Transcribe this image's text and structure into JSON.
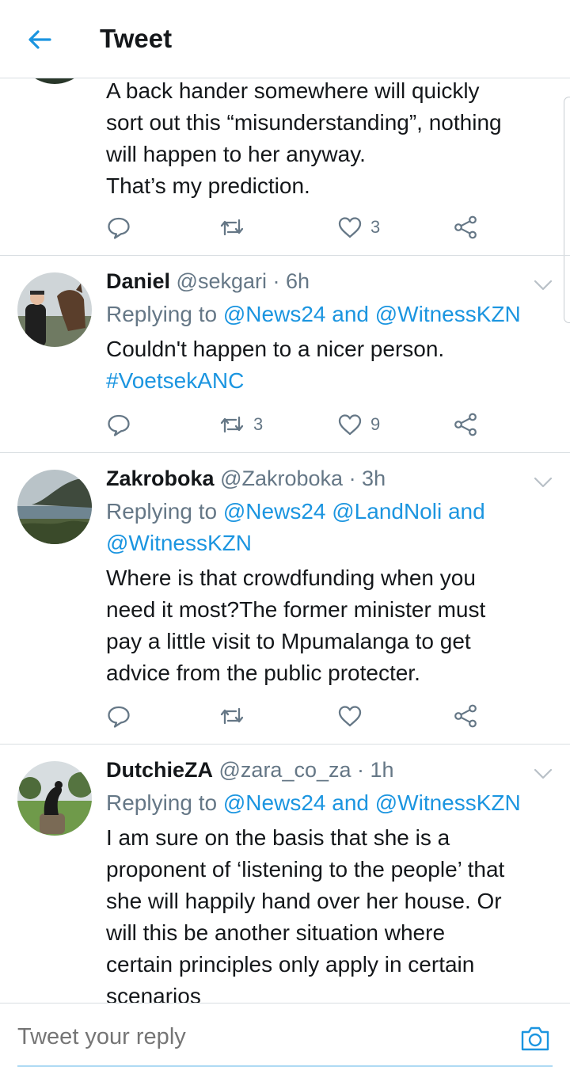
{
  "header": {
    "title": "Tweet",
    "back_icon": "arrow-left-icon",
    "accent": "#1b95e0"
  },
  "tweets": [
    {
      "text_lines": [
        "A back hander somewhere will quickly",
        "sort out this “misunderstanding”, nothing",
        "will happen to her anyway.",
        "That’s my prediction."
      ],
      "likes": "3"
    },
    {
      "name": "Daniel",
      "handle": "@sekgari",
      "time": "· 6h",
      "reply_prefix": "Replying to",
      "reply_line1_a": "@News24",
      "reply_line1_and": "and",
      "reply_line1_b": "@WitnessKZN",
      "text_lines": [
        "Couldn't happen to a nicer person."
      ],
      "hashtag": "#VoetsekANC",
      "retweets": "3",
      "likes": "9"
    },
    {
      "name": "Zakroboka",
      "handle": "@Zakroboka",
      "time": "· 3h",
      "reply_prefix": "Replying to",
      "reply_line1_a": "@News24",
      "reply_line1_b": "@LandNoli",
      "reply_line1_and": "and",
      "reply_line2": "@WitnessKZN",
      "text_lines": [
        "Where is that crowdfunding when you",
        "need it most?The former minister must",
        "pay a little visit to Mpumalanga to get",
        "advice from the public protecter."
      ]
    },
    {
      "name": "DutchieZA",
      "handle": "@zara_co_za",
      "time": "· 1h",
      "reply_prefix": "Replying to",
      "reply_line1_a": "@News24",
      "reply_line1_and": "and",
      "reply_line1_b": "@WitnessKZN",
      "text_lines": [
        "I am sure on the basis that she is a",
        "proponent of ‘listening to the people’ that",
        "she will happily hand over her house. Or",
        "will this be another situation where",
        "certain principles only apply in certain",
        "scenarios"
      ]
    }
  ],
  "composer": {
    "placeholder": "Tweet your reply",
    "camera_icon": "camera-icon"
  }
}
